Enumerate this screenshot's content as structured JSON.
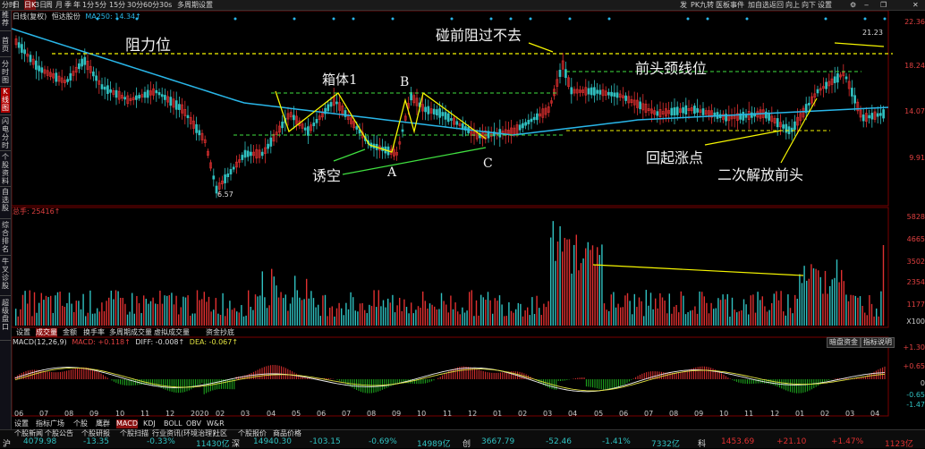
{
  "toolbar": {
    "left_items": [
      "分时",
      "日",
      "日K",
      "3日",
      "周",
      "月",
      "季",
      "年",
      "1分",
      "5分",
      "15分",
      "30分",
      "60分",
      "30s",
      "多周期",
      "设置"
    ],
    "right_items": [
      "发",
      "PK",
      "九转",
      "医板",
      "事件",
      "加自选",
      "返回",
      "向上",
      "向下",
      "设置"
    ]
  },
  "sidebar": {
    "items": [
      "推荐",
      "首页",
      "分时图",
      "K线图",
      "闪电分时",
      "个股资料",
      "自选股",
      "综合排名",
      "牛叉诊股",
      "超级盘口"
    ],
    "active": "K线图"
  },
  "price_panel": {
    "info_title": "日线(复权)",
    "info_name": "恒达股份",
    "info_ma": "MA250: 14.34↑",
    "axis_labels": [
      "22.36",
      "18.24",
      "14.07",
      "9.91"
    ],
    "top_label": "21.23",
    "low_label": "6.57",
    "annotations": {
      "resistance": "阻力位",
      "box1": "箱体1",
      "point_b": "B",
      "point_a": "A",
      "point_c": "C",
      "trap": "诱空",
      "hit_resistance": "碰前阻过不去",
      "neckline": "前头颈线位",
      "rebound": "回起涨点",
      "second_break": "二次解放前头"
    }
  },
  "volume_panel": {
    "title": "总手: 25416↑",
    "axis_labels": [
      "5828",
      "4665",
      "3502",
      "2354",
      "1177",
      "X100"
    ],
    "tabs": [
      "设置",
      "成交量",
      "金额",
      "换手率",
      "多周期成交量",
      "虚拟成交量",
      "资金抄底"
    ],
    "active_tab": "成交量"
  },
  "macd_panel": {
    "title": "MACD(12,26,9)",
    "macd": "MACD: +0.118↑",
    "diff": "DIFF: -0.008↑",
    "dea": "DEA: -0.067↑",
    "right_buttons": [
      "暗盘资金",
      "指标说明"
    ],
    "axis_labels": [
      "+1.30",
      "+0.65",
      "0",
      "-0.65",
      "-1.47"
    ]
  },
  "date_axis": [
    "06",
    "07",
    "08",
    "09",
    "10",
    "11",
    "12",
    "2020",
    "02",
    "03",
    "04",
    "05",
    "06",
    "07",
    "08",
    "09",
    "10",
    "11",
    "12",
    "01",
    "02",
    "03",
    "04",
    "05",
    "06",
    "07",
    "08",
    "09",
    "10",
    "11",
    "12",
    "01",
    "02",
    "03",
    "04"
  ],
  "panel_tabs": [
    "设置",
    "指标广场",
    "个股",
    "鹰群",
    "MACD",
    "KDJ",
    "BOLL",
    "OBV",
    "W&R"
  ],
  "panel_active": "MACD",
  "bottom_links": [
    "个股新闻",
    "个股公告",
    "个股研报",
    "个股扫描",
    "行业资讯(环境治理)",
    "社区",
    "个股报价",
    "商品价格"
  ],
  "status": {
    "sh_label": "沪",
    "sh_index": "4079.98",
    "sh_change": "-13.35",
    "sh_pct": "-0.33%",
    "sh_amount": "11430亿",
    "sz_label": "深",
    "sz_index": "14940.30",
    "sz_change": "-103.15",
    "sz_pct": "-0.69%",
    "sz_amount": "14989亿",
    "cy_label": "创",
    "cy_index": "3667.79",
    "cy_change": "-52.46",
    "cy_pct": "-1.41%",
    "cy_amount": "7332亿",
    "kc_label": "科",
    "kc_index": "1453.69",
    "kc_change": "+21.10",
    "kc_pct": "+1.47%",
    "kc_amount": "1123亿"
  },
  "colors": {
    "up": "#e03030",
    "down": "#30c0c0",
    "ma250": "#29b6e8",
    "annotation_line": "#f5f500",
    "green_line": "#40e040",
    "macd_up": "#e03030",
    "macd_down": "#20b020"
  }
}
